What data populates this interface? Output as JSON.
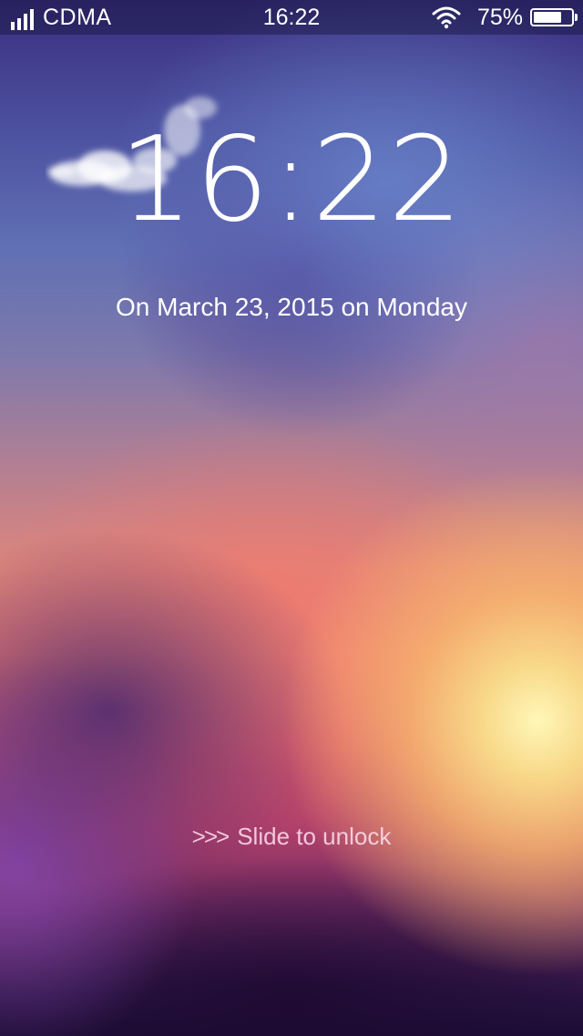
{
  "status_bar": {
    "carrier": "CDMA",
    "time": "16:22",
    "battery_percent_label": "75%",
    "battery_level": 0.75,
    "signal_icon": "signal-bars-icon",
    "wifi_icon": "wifi-icon",
    "battery_icon": "battery-icon"
  },
  "lock_screen": {
    "clock": "16:22",
    "date": "On March 23, 2015 on Monday",
    "unlock_chevrons": ">>>",
    "unlock_label": "Slide to unlock"
  },
  "colors": {
    "text": "#ffffff",
    "unlock_text": "#f0d8ea",
    "sky_top": "#3a2f7e",
    "sunset_glow": "#fff7b8"
  }
}
